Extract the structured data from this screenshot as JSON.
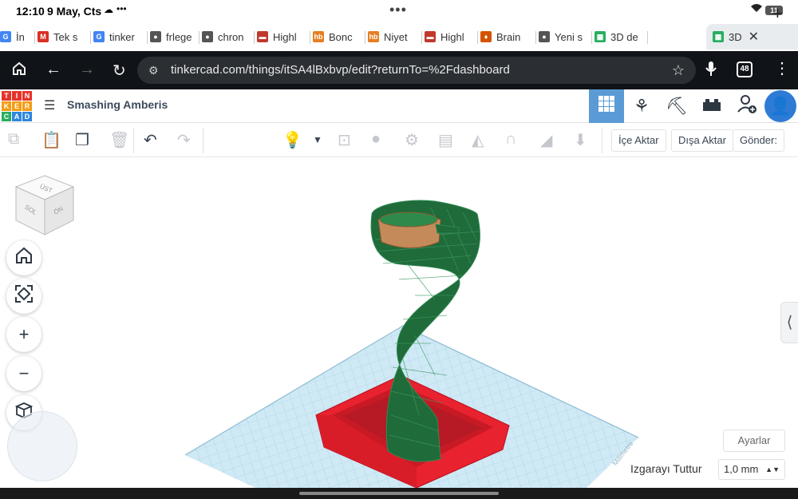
{
  "status": {
    "time": "12:10",
    "date": "9 May, Cts",
    "battery": "11"
  },
  "tabs": [
    {
      "label": "İndiri",
      "fav": "G",
      "color": "#4285f4"
    },
    {
      "label": "Tek s",
      "fav": "M",
      "color": "#d93025"
    },
    {
      "label": "tinker",
      "fav": "G",
      "color": "#4285f4"
    },
    {
      "label": "frlege",
      "fav": "●",
      "color": "#555"
    },
    {
      "label": "chron",
      "fav": "●",
      "color": "#555"
    },
    {
      "label": "Highl",
      "fav": "▬",
      "color": "#c0392b"
    },
    {
      "label": "Bonc",
      "fav": "hb",
      "color": "#e67e22"
    },
    {
      "label": "Niyet",
      "fav": "hb",
      "color": "#e67e22"
    },
    {
      "label": "Highl",
      "fav": "▬",
      "color": "#c0392b"
    },
    {
      "label": "Brain",
      "fav": "♦",
      "color": "#d35400"
    },
    {
      "label": "Yeni s",
      "fav": "●",
      "color": "#555"
    },
    {
      "label": "3D de",
      "fav": "▦",
      "color": "#27ae60"
    },
    {
      "label": "3D",
      "fav": "▦",
      "color": "#27ae60",
      "active": true
    }
  ],
  "browser": {
    "url": "tinkercad.com/things/itSA4lBxbvp/edit?returnTo=%2Fdashboard",
    "tab_count": "48"
  },
  "app": {
    "logo_letters": [
      "T",
      "I",
      "N",
      "K",
      "E",
      "R",
      "C",
      "A",
      "D"
    ],
    "logo_colors": [
      "#e63329",
      "#e63329",
      "#e63329",
      "#f39c12",
      "#f39c12",
      "#f39c12",
      "#27ae60",
      "#2e86de",
      "#2e86de"
    ],
    "project_title": "Smashing Amberis"
  },
  "toolbar": {
    "import_label": "İçe Aktar",
    "export_label": "Dışa Aktar",
    "send_label": "Gönder:"
  },
  "viewcube": {
    "top": "ÜST",
    "left": "SOL",
    "front": "ÖN"
  },
  "workplane": {
    "grid_label": "Milimetre",
    "settings_label": "Ayarlar",
    "snap_label": "Izgarayı Tuttur",
    "snap_value": "1,0 mm"
  },
  "colors": {
    "accent": "#5b9bd5",
    "shape_green": "#1f6b3a",
    "base_red": "#e8222f",
    "ring_orange": "#c58a5a",
    "grid_blue": "#bfe0ef"
  }
}
